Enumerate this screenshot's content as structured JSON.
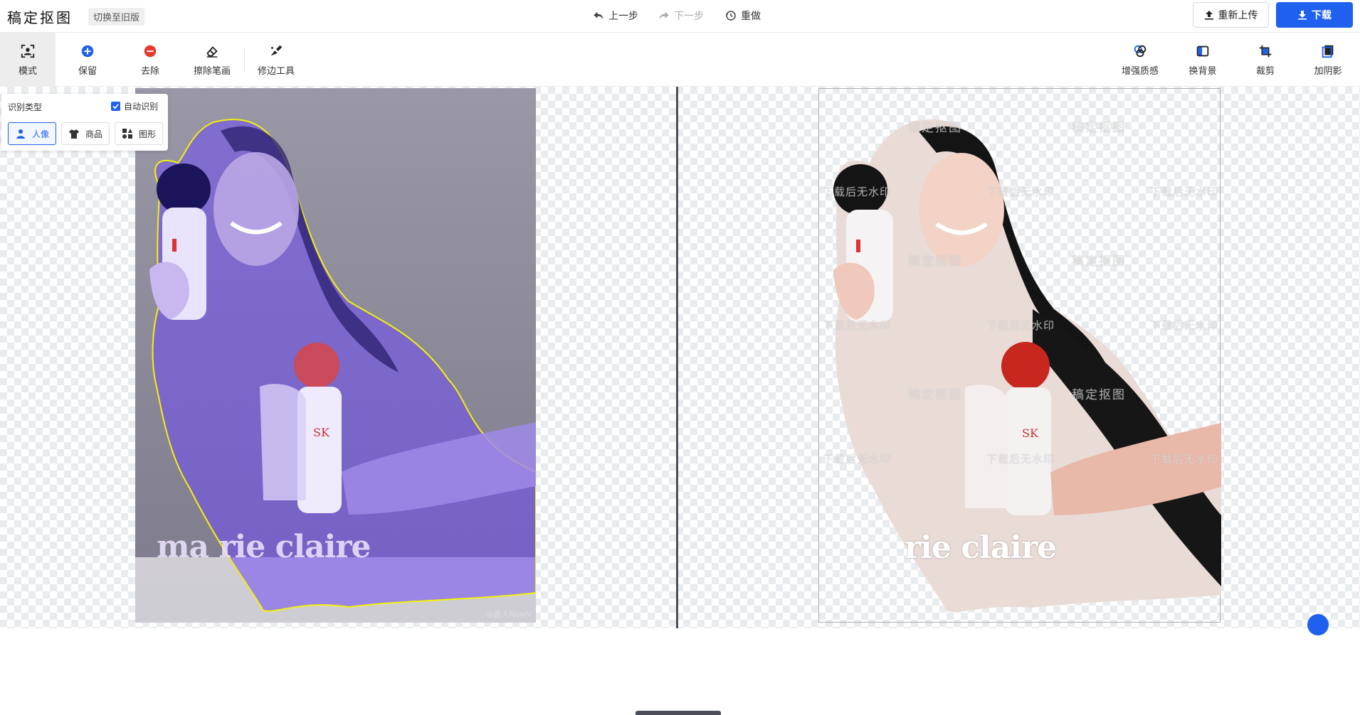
{
  "header": {
    "app_title": "稿定抠图",
    "switch_old_label": "切换至旧版",
    "undo_label": "上一步",
    "redo_label": "下一步",
    "reset_label": "重做",
    "reupload_label": "重新上传",
    "download_label": "下载"
  },
  "toolbar": {
    "mode_label": "模式",
    "keep_label": "保留",
    "remove_label": "去除",
    "erase_label": "擦除笔画",
    "edge_tool_label": "修边工具",
    "enhance_label": "增强质感",
    "change_bg_label": "换背景",
    "crop_label": "裁剪",
    "shadow_label": "加阴影"
  },
  "recognition": {
    "title": "识别类型",
    "auto_label": "自动识别",
    "auto_checked": true,
    "types": [
      {
        "label": "人像",
        "icon": "person-icon",
        "active": true
      },
      {
        "label": "商品",
        "icon": "tshirt-icon",
        "active": false
      },
      {
        "label": "图形",
        "icon": "shapes-icon",
        "active": false
      }
    ]
  },
  "canvas": {
    "left_brand_text": "ma rie claire",
    "left_brand_script": "嘉人",
    "left_credit": "@嘉人NowV",
    "right_brand_text": "rie claire",
    "watermark_logo": "稿定抠图",
    "watermark_note": "下载后无水印"
  },
  "colors": {
    "accent": "#1f60ee",
    "keep_icon": "#1f60ee",
    "remove_icon": "#e8392f",
    "overlay_purple": "#7b5cf0",
    "selection_outline": "#f2f20a",
    "divider": "#4a4f59"
  }
}
